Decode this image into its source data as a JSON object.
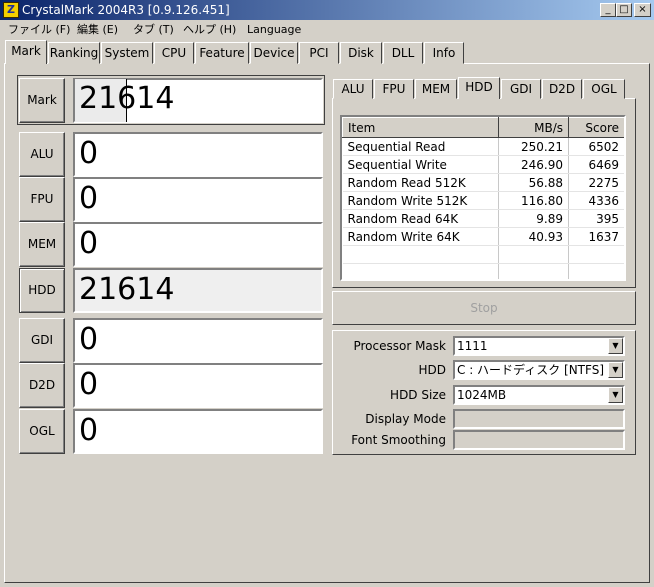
{
  "window": {
    "title": "CrystalMark 2004R3 [0.9.126.451]",
    "icon": "crystalmark-app-icon",
    "min_glyph": "_",
    "max_glyph": "□",
    "close_glyph": "×"
  },
  "menu": [
    "ファイル (F)",
    "編集 (E)",
    "タブ (T)",
    "ヘルプ (H)",
    "Language"
  ],
  "tabs": [
    "Mark",
    "Ranking",
    "System",
    "CPU",
    "Feature",
    "Device",
    "PCI",
    "Disk",
    "DLL",
    "Info"
  ],
  "active_tab": "Mark",
  "scores": {
    "mark": {
      "label": "Mark",
      "value": "21614"
    },
    "alu": {
      "label": "ALU",
      "value": "0"
    },
    "fpu": {
      "label": "FPU",
      "value": "0"
    },
    "mem": {
      "label": "MEM",
      "value": "0"
    },
    "hdd": {
      "label": "HDD",
      "value": "21614"
    },
    "gdi": {
      "label": "GDI",
      "value": "0"
    },
    "d2d": {
      "label": "D2D",
      "value": "0"
    },
    "ogl": {
      "label": "OGL",
      "value": "0"
    }
  },
  "subtabs": [
    "ALU",
    "FPU",
    "MEM",
    "HDD",
    "GDI",
    "D2D",
    "OGL"
  ],
  "active_subtab": "HDD",
  "results": {
    "headers": [
      "Item",
      "MB/s",
      "Score"
    ],
    "rows": [
      [
        "Sequential Read",
        "250.21",
        "6502"
      ],
      [
        "Sequential Write",
        "246.90",
        "6469"
      ],
      [
        "Random Read 512K",
        "56.88",
        "2275"
      ],
      [
        "Random Write 512K",
        "116.80",
        "4336"
      ],
      [
        "Random Read 64K",
        "9.89",
        "395"
      ],
      [
        "Random Write 64K",
        "40.93",
        "1637"
      ]
    ]
  },
  "stop_label": "Stop",
  "options": {
    "processor_mask": {
      "label": "Processor Mask",
      "value": "1111"
    },
    "hdd": {
      "label": "HDD",
      "value": "C : ハードディスク [NTFS]"
    },
    "hdd_size": {
      "label": "HDD Size",
      "value": "1024MB"
    },
    "display_mode": {
      "label": "Display Mode",
      "value": ""
    },
    "font_smoothing": {
      "label": "Font Smoothing",
      "value": ""
    },
    "dropdown_glyph": "▼"
  }
}
